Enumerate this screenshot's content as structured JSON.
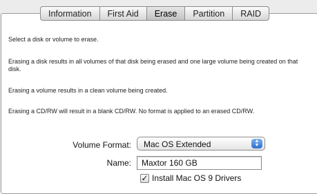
{
  "tabs": [
    {
      "label": "Information",
      "active": false
    },
    {
      "label": "First Aid",
      "active": false
    },
    {
      "label": "Erase",
      "active": true
    },
    {
      "label": "Partition",
      "active": false
    },
    {
      "label": "RAID",
      "active": false
    }
  ],
  "content": {
    "paragraphs": [
      "Select a disk or volume to erase.",
      "Erasing a disk results in all volumes of that disk being erased and one large volume being created on that disk.",
      "Erasing a volume results in a clean volume being created.",
      "Erasing a CD/RW will result in a blank CD/RW.  No format is applied to an erased CD/RW."
    ]
  },
  "form": {
    "volume_format_label": "Volume Format:",
    "volume_format_value": "Mac OS Extended",
    "popup_arrows_icon": "up-down-arrows-icon",
    "name_label": "Name:",
    "name_value": "Maxtor 160 GB",
    "install_drivers_checked": true,
    "install_drivers_label": "Install Mac OS 9 Drivers",
    "checkmark_icon": "checkmark-icon"
  },
  "colors": {
    "popup_accent": "#2d6fd0",
    "active_tab": "#c2c2c2"
  }
}
